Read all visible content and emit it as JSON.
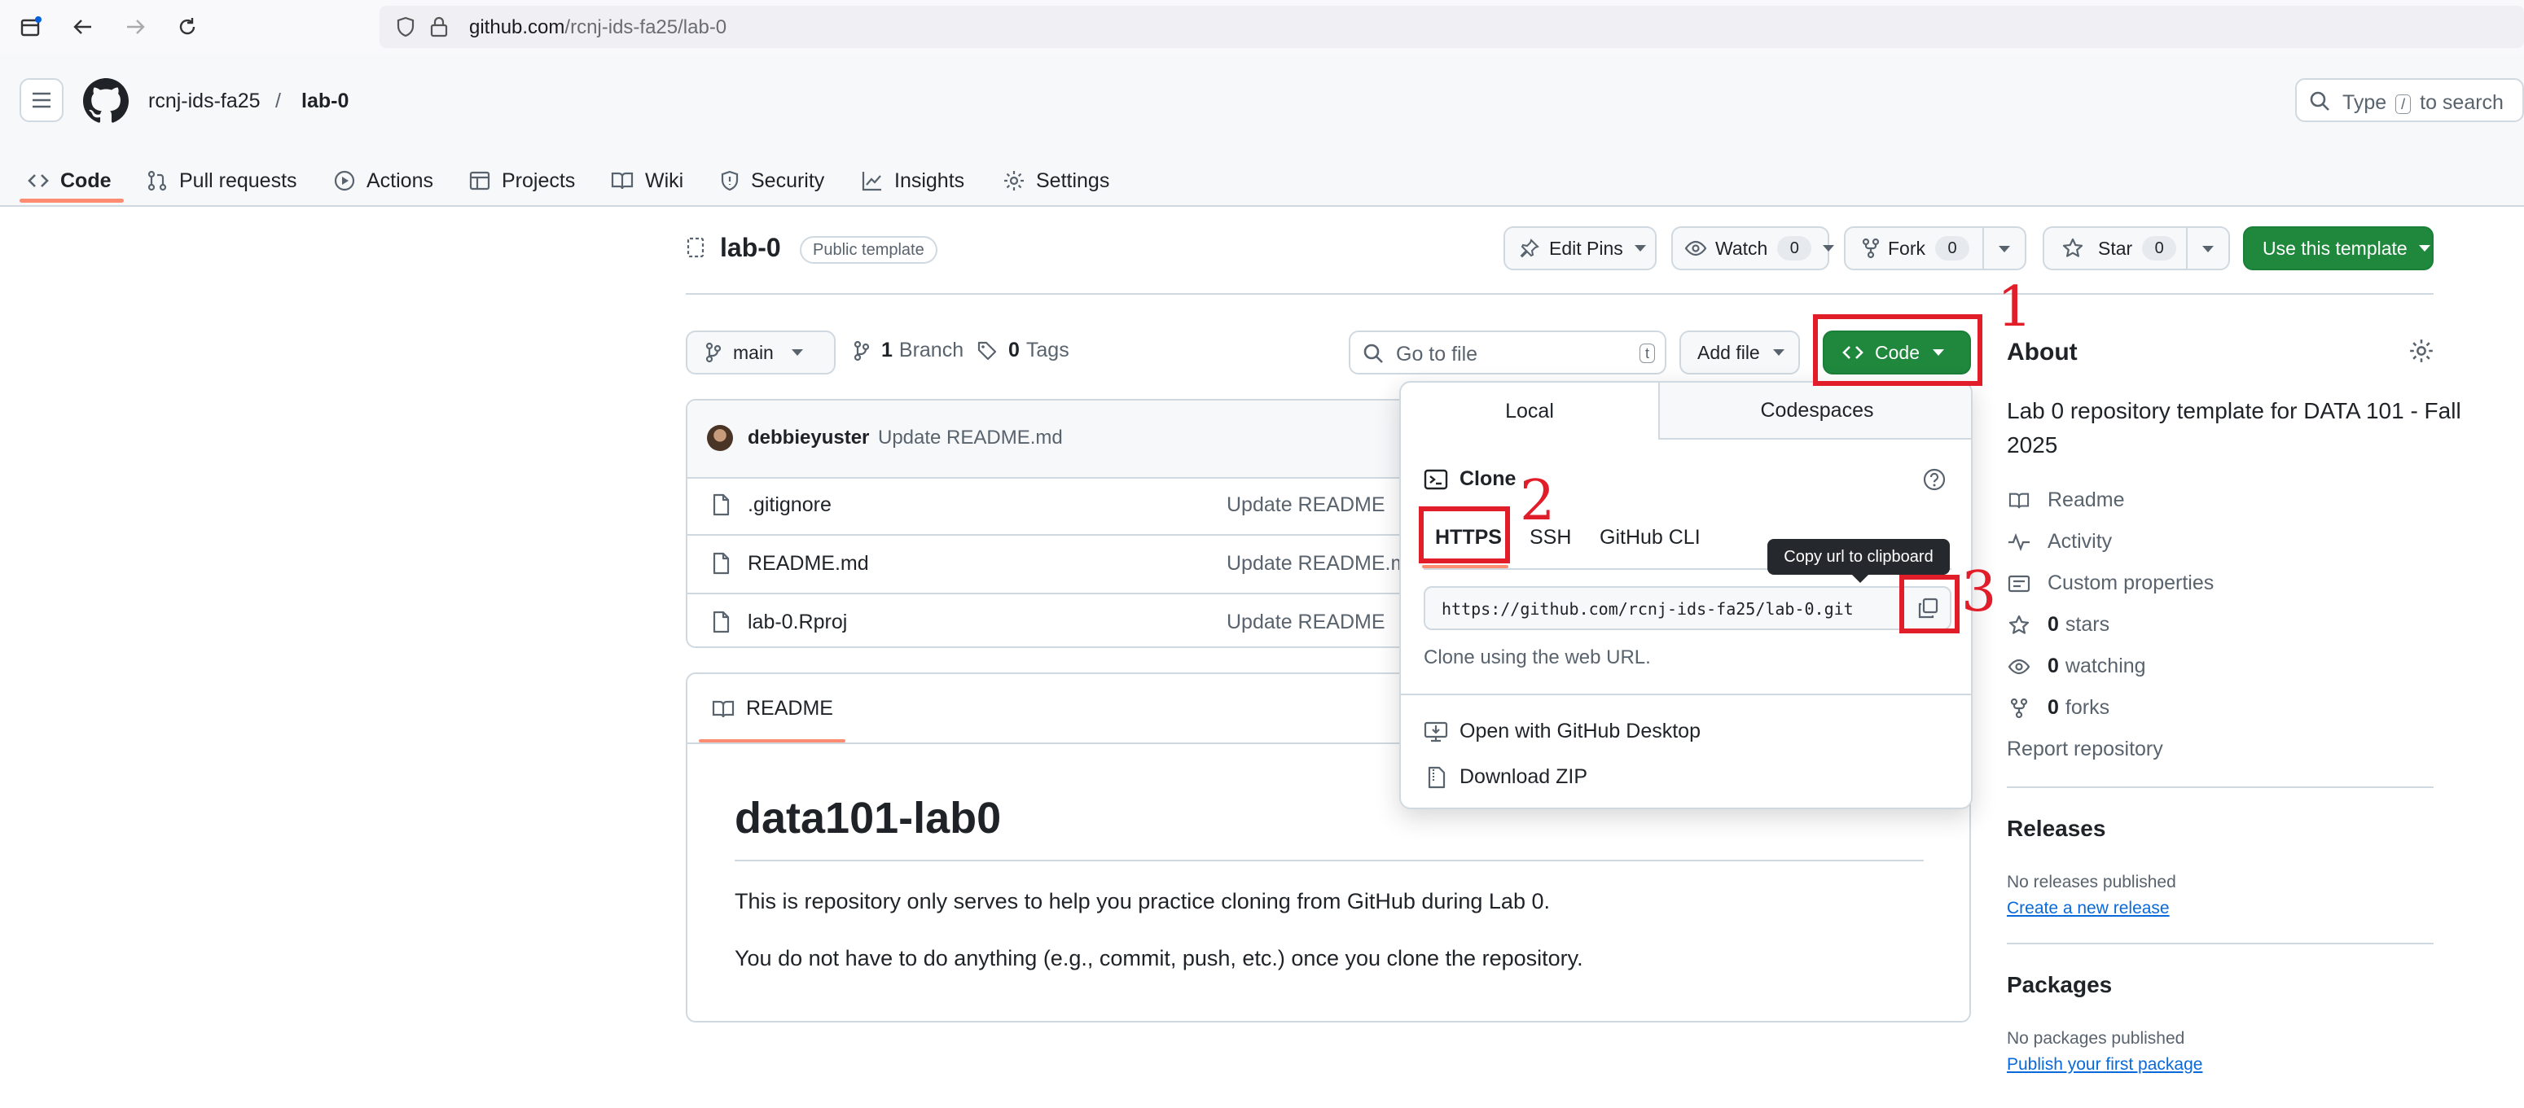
{
  "browser": {
    "url_host": "github.com",
    "url_path": "/rcnj-ids-fa25/lab-0"
  },
  "header": {
    "owner": "rcnj-ids-fa25",
    "separator": "/",
    "repo": "lab-0",
    "search_prefix": "Type",
    "search_key": "/",
    "search_suffix": "to search"
  },
  "nav_tabs": [
    {
      "label": "Code",
      "icon": "code-icon"
    },
    {
      "label": "Pull requests",
      "icon": "git-pull-request-icon"
    },
    {
      "label": "Actions",
      "icon": "play-icon"
    },
    {
      "label": "Projects",
      "icon": "table-icon"
    },
    {
      "label": "Wiki",
      "icon": "book-icon"
    },
    {
      "label": "Security",
      "icon": "shield-icon"
    },
    {
      "label": "Insights",
      "icon": "graph-icon"
    },
    {
      "label": "Settings",
      "icon": "gear-icon"
    }
  ],
  "repo": {
    "name": "lab-0",
    "visibility": "Public template",
    "edit_pins": "Edit Pins",
    "watch": "Watch",
    "watch_count": "0",
    "fork": "Fork",
    "fork_count": "0",
    "star": "Star",
    "star_count": "0",
    "use_template": "Use this template"
  },
  "filenav": {
    "branch": "main",
    "branch_count": "1",
    "branch_label": "Branch",
    "tag_count": "0",
    "tag_label": "Tags",
    "goto_placeholder": "Go to file",
    "goto_key": "t",
    "add_file": "Add file",
    "code": "Code"
  },
  "latest_commit": {
    "author": "debbieyuster",
    "message": "Update README.md"
  },
  "files": [
    {
      "name": ".gitignore",
      "commit": "Update README"
    },
    {
      "name": "README.md",
      "commit": "Update README.md"
    },
    {
      "name": "lab-0.Rproj",
      "commit": "Update README"
    }
  ],
  "readme": {
    "tab": "README",
    "heading": "data101-lab0",
    "p1": "This is repository only serves to help you practice cloning from GitHub during Lab 0.",
    "p2": "You do not have to do anything (e.g., commit, push, etc.) once you clone the repository."
  },
  "code_dropdown": {
    "tab_local": "Local",
    "tab_codespaces": "Codespaces",
    "clone_title": "Clone",
    "protocols": [
      "HTTPS",
      "SSH",
      "GitHub CLI"
    ],
    "selected_protocol": "HTTPS",
    "clone_url": "https://github.com/rcnj-ids-fa25/lab-0.git",
    "clone_help": "Clone using the web URL.",
    "open_desktop": "Open with GitHub Desktop",
    "download_zip": "Download ZIP",
    "tooltip": "Copy url to clipboard"
  },
  "annotations": {
    "n1": "1",
    "n2": "2",
    "n3": "3",
    "color": "#e11d2a"
  },
  "sidebar": {
    "about_title": "About",
    "description": "Lab 0 repository template for DATA 101 - Fall 2025",
    "readme": "Readme",
    "activity": "Activity",
    "custom_properties": "Custom properties",
    "stars_count": "0",
    "stars_label": "stars",
    "watching_count": "0",
    "watching_label": "watching",
    "forks_count": "0",
    "forks_label": "forks",
    "report": "Report repository",
    "releases_title": "Releases",
    "releases_none": "No releases published",
    "create_release": "Create a new release",
    "packages_title": "Packages",
    "packages_none": "No packages published",
    "publish_package": "Publish your first package"
  },
  "colors": {
    "accent_green": "#1f883d",
    "link_blue": "#0969da",
    "tab_underline": "#fd8c73",
    "border": "#d1d9e0"
  }
}
